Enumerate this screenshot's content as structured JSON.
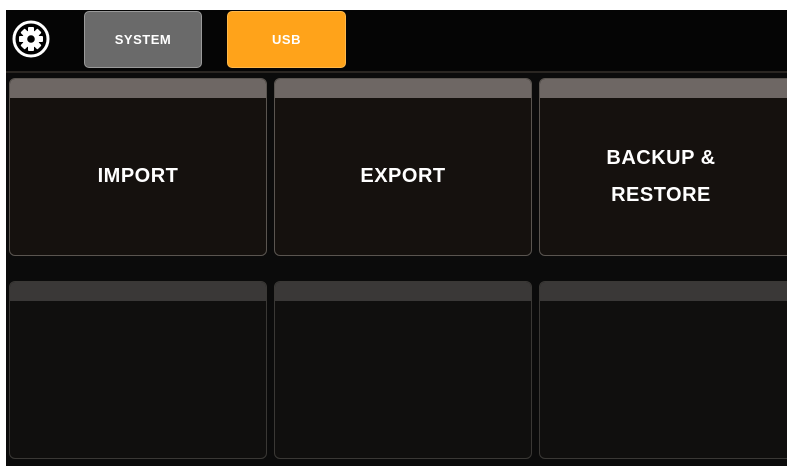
{
  "header": {
    "settings_icon": "gear-icon",
    "tabs": [
      {
        "label": "SYSTEM",
        "active": false,
        "color": "#6a6a6a"
      },
      {
        "label": "USB",
        "active": true,
        "color": "#ffa31a"
      }
    ]
  },
  "tiles": [
    {
      "label": "IMPORT"
    },
    {
      "label": "EXPORT"
    },
    {
      "label": "BACKUP &\nRESTORE"
    },
    {
      "label": ""
    },
    {
      "label": ""
    },
    {
      "label": ""
    }
  ],
  "colors": {
    "accent": "#ffa31a",
    "background": "#0b0b0b",
    "tile_header": "#6e6764"
  }
}
